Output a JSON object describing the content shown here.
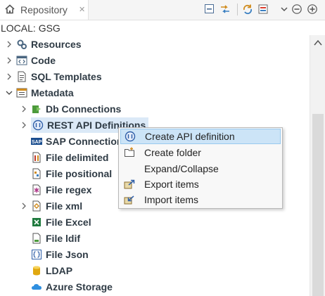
{
  "view": {
    "tab_title": "Repository",
    "close_glyph": "✕",
    "location": "LOCAL: GSG"
  },
  "tree": {
    "items": [
      {
        "label": "Resources",
        "icon": "resources-icon"
      },
      {
        "label": "Code",
        "icon": "code-icon"
      },
      {
        "label": "SQL Templates",
        "icon": "sql-templates-icon"
      },
      {
        "label": "Metadata",
        "icon": "metadata-icon"
      },
      {
        "label": "Db Connections",
        "icon": "db-connections-icon"
      },
      {
        "label": "REST API Definitions",
        "icon": "rest-api-icon"
      },
      {
        "label": "SAP Connections",
        "icon": "sap-icon"
      },
      {
        "label": "File delimited",
        "icon": "file-delimited-icon"
      },
      {
        "label": "File positional",
        "icon": "file-positional-icon"
      },
      {
        "label": "File regex",
        "icon": "file-regex-icon"
      },
      {
        "label": "File xml",
        "icon": "file-xml-icon"
      },
      {
        "label": "File Excel",
        "icon": "file-excel-icon"
      },
      {
        "label": "File ldif",
        "icon": "file-ldif-icon"
      },
      {
        "label": "File Json",
        "icon": "file-json-icon"
      },
      {
        "label": "LDAP",
        "icon": "ldap-icon"
      },
      {
        "label": "Azure Storage",
        "icon": "azure-storage-icon"
      }
    ]
  },
  "context_menu": {
    "items": [
      {
        "label": "Create API definition",
        "icon": "api-definition-icon"
      },
      {
        "label": "Create folder",
        "icon": "folder-icon"
      },
      {
        "label": "Expand/Collapse",
        "icon": ""
      },
      {
        "label": "Export items",
        "icon": "export-icon"
      },
      {
        "label": "Import items",
        "icon": "import-icon"
      }
    ]
  },
  "colors": {
    "selection": "#dbe9f7",
    "menu_highlight": "#cce4f7",
    "accent": "#2f7ac2"
  }
}
